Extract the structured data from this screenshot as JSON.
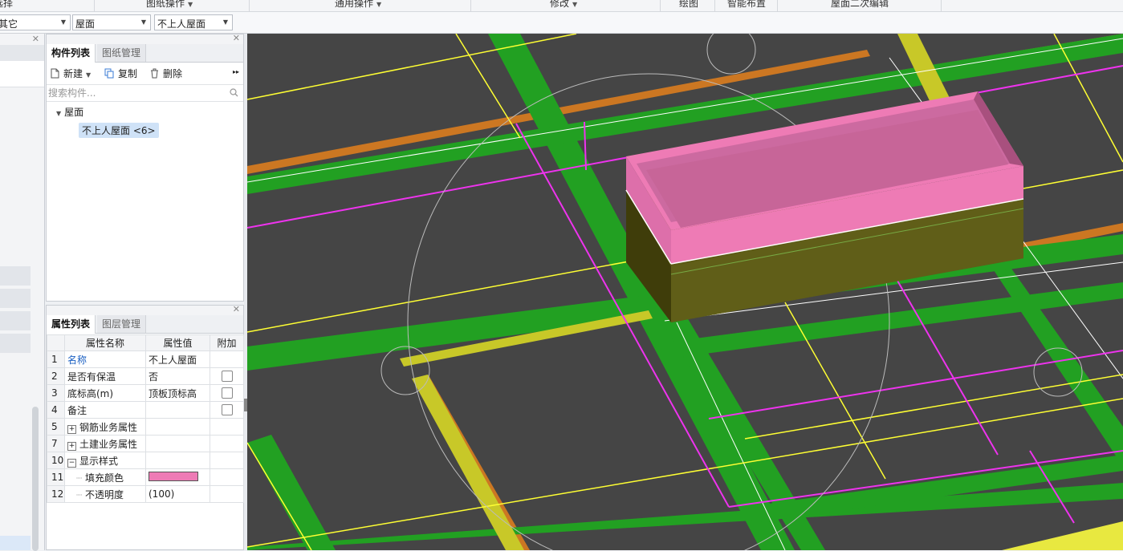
{
  "ribbon": {
    "groups": [
      "选择",
      "图纸操作",
      "通用操作",
      "修改",
      "绘图",
      "智能布置",
      "屋面二次编辑"
    ]
  },
  "toolbar": {
    "combo1": "其它",
    "combo2": "屋面",
    "combo3": "不上人屋面"
  },
  "component_panel": {
    "tabs": [
      "构件列表",
      "图纸管理"
    ],
    "actions": {
      "new": "新建",
      "copy": "复制",
      "delete": "删除"
    },
    "search_placeholder": "搜索构件...",
    "tree_root": "屋面",
    "tree_child": "不上人屋面 <6>"
  },
  "property_panel": {
    "tabs": [
      "属性列表",
      "图层管理"
    ],
    "headers": [
      "属性名称",
      "属性值",
      "附加"
    ],
    "rows": [
      {
        "num": "1",
        "name": "名称",
        "value": "不上人屋面"
      },
      {
        "num": "2",
        "name": "是否有保温",
        "value": "否"
      },
      {
        "num": "3",
        "name": "底标高(m)",
        "value": "顶板顶标高"
      },
      {
        "num": "4",
        "name": "备注",
        "value": ""
      },
      {
        "num": "5",
        "name": "钢筋业务属性",
        "value": ""
      },
      {
        "num": "7",
        "name": "土建业务属性",
        "value": ""
      },
      {
        "num": "10",
        "name": "显示样式",
        "value": ""
      },
      {
        "num": "11",
        "name": "填充颜色",
        "value": ""
      },
      {
        "num": "12",
        "name": "不透明度",
        "value": "(100)"
      }
    ],
    "fill_color": "#ee7bb5"
  },
  "colors": {
    "viewport_bg": "#454545",
    "beam_green": "#22a022",
    "axis_yellow": "#ffff33",
    "magenta_line": "#ee33ee",
    "orange_wall": "#cc7722",
    "roof_pink": "#ee7bb5",
    "slab_olive": "#5c5a14"
  }
}
